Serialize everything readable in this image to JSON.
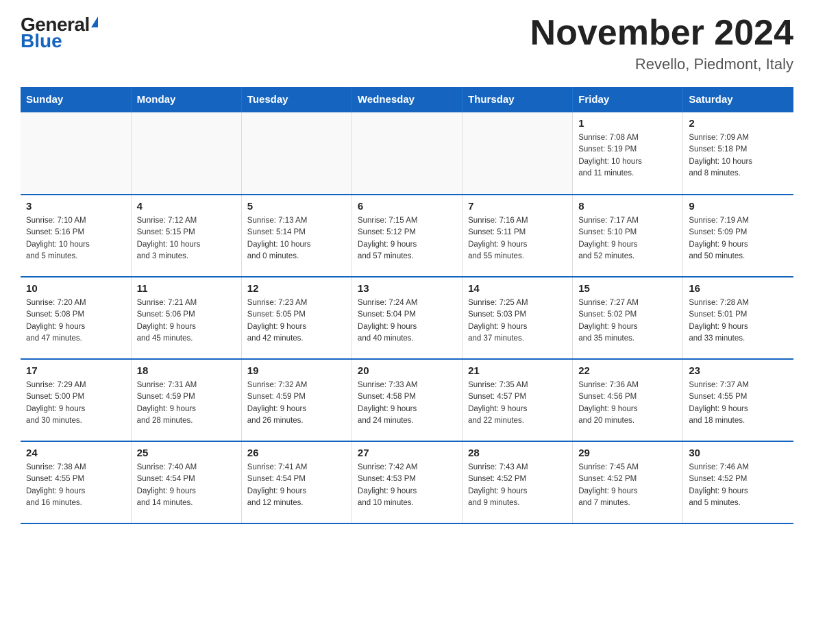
{
  "header": {
    "logo_general": "General",
    "logo_blue": "Blue",
    "title": "November 2024",
    "subtitle": "Revello, Piedmont, Italy"
  },
  "weekdays": [
    "Sunday",
    "Monday",
    "Tuesday",
    "Wednesday",
    "Thursday",
    "Friday",
    "Saturday"
  ],
  "weeks": [
    [
      {
        "day": "",
        "info": ""
      },
      {
        "day": "",
        "info": ""
      },
      {
        "day": "",
        "info": ""
      },
      {
        "day": "",
        "info": ""
      },
      {
        "day": "",
        "info": ""
      },
      {
        "day": "1",
        "info": "Sunrise: 7:08 AM\nSunset: 5:19 PM\nDaylight: 10 hours\nand 11 minutes."
      },
      {
        "day": "2",
        "info": "Sunrise: 7:09 AM\nSunset: 5:18 PM\nDaylight: 10 hours\nand 8 minutes."
      }
    ],
    [
      {
        "day": "3",
        "info": "Sunrise: 7:10 AM\nSunset: 5:16 PM\nDaylight: 10 hours\nand 5 minutes."
      },
      {
        "day": "4",
        "info": "Sunrise: 7:12 AM\nSunset: 5:15 PM\nDaylight: 10 hours\nand 3 minutes."
      },
      {
        "day": "5",
        "info": "Sunrise: 7:13 AM\nSunset: 5:14 PM\nDaylight: 10 hours\nand 0 minutes."
      },
      {
        "day": "6",
        "info": "Sunrise: 7:15 AM\nSunset: 5:12 PM\nDaylight: 9 hours\nand 57 minutes."
      },
      {
        "day": "7",
        "info": "Sunrise: 7:16 AM\nSunset: 5:11 PM\nDaylight: 9 hours\nand 55 minutes."
      },
      {
        "day": "8",
        "info": "Sunrise: 7:17 AM\nSunset: 5:10 PM\nDaylight: 9 hours\nand 52 minutes."
      },
      {
        "day": "9",
        "info": "Sunrise: 7:19 AM\nSunset: 5:09 PM\nDaylight: 9 hours\nand 50 minutes."
      }
    ],
    [
      {
        "day": "10",
        "info": "Sunrise: 7:20 AM\nSunset: 5:08 PM\nDaylight: 9 hours\nand 47 minutes."
      },
      {
        "day": "11",
        "info": "Sunrise: 7:21 AM\nSunset: 5:06 PM\nDaylight: 9 hours\nand 45 minutes."
      },
      {
        "day": "12",
        "info": "Sunrise: 7:23 AM\nSunset: 5:05 PM\nDaylight: 9 hours\nand 42 minutes."
      },
      {
        "day": "13",
        "info": "Sunrise: 7:24 AM\nSunset: 5:04 PM\nDaylight: 9 hours\nand 40 minutes."
      },
      {
        "day": "14",
        "info": "Sunrise: 7:25 AM\nSunset: 5:03 PM\nDaylight: 9 hours\nand 37 minutes."
      },
      {
        "day": "15",
        "info": "Sunrise: 7:27 AM\nSunset: 5:02 PM\nDaylight: 9 hours\nand 35 minutes."
      },
      {
        "day": "16",
        "info": "Sunrise: 7:28 AM\nSunset: 5:01 PM\nDaylight: 9 hours\nand 33 minutes."
      }
    ],
    [
      {
        "day": "17",
        "info": "Sunrise: 7:29 AM\nSunset: 5:00 PM\nDaylight: 9 hours\nand 30 minutes."
      },
      {
        "day": "18",
        "info": "Sunrise: 7:31 AM\nSunset: 4:59 PM\nDaylight: 9 hours\nand 28 minutes."
      },
      {
        "day": "19",
        "info": "Sunrise: 7:32 AM\nSunset: 4:59 PM\nDaylight: 9 hours\nand 26 minutes."
      },
      {
        "day": "20",
        "info": "Sunrise: 7:33 AM\nSunset: 4:58 PM\nDaylight: 9 hours\nand 24 minutes."
      },
      {
        "day": "21",
        "info": "Sunrise: 7:35 AM\nSunset: 4:57 PM\nDaylight: 9 hours\nand 22 minutes."
      },
      {
        "day": "22",
        "info": "Sunrise: 7:36 AM\nSunset: 4:56 PM\nDaylight: 9 hours\nand 20 minutes."
      },
      {
        "day": "23",
        "info": "Sunrise: 7:37 AM\nSunset: 4:55 PM\nDaylight: 9 hours\nand 18 minutes."
      }
    ],
    [
      {
        "day": "24",
        "info": "Sunrise: 7:38 AM\nSunset: 4:55 PM\nDaylight: 9 hours\nand 16 minutes."
      },
      {
        "day": "25",
        "info": "Sunrise: 7:40 AM\nSunset: 4:54 PM\nDaylight: 9 hours\nand 14 minutes."
      },
      {
        "day": "26",
        "info": "Sunrise: 7:41 AM\nSunset: 4:54 PM\nDaylight: 9 hours\nand 12 minutes."
      },
      {
        "day": "27",
        "info": "Sunrise: 7:42 AM\nSunset: 4:53 PM\nDaylight: 9 hours\nand 10 minutes."
      },
      {
        "day": "28",
        "info": "Sunrise: 7:43 AM\nSunset: 4:52 PM\nDaylight: 9 hours\nand 9 minutes."
      },
      {
        "day": "29",
        "info": "Sunrise: 7:45 AM\nSunset: 4:52 PM\nDaylight: 9 hours\nand 7 minutes."
      },
      {
        "day": "30",
        "info": "Sunrise: 7:46 AM\nSunset: 4:52 PM\nDaylight: 9 hours\nand 5 minutes."
      }
    ]
  ]
}
